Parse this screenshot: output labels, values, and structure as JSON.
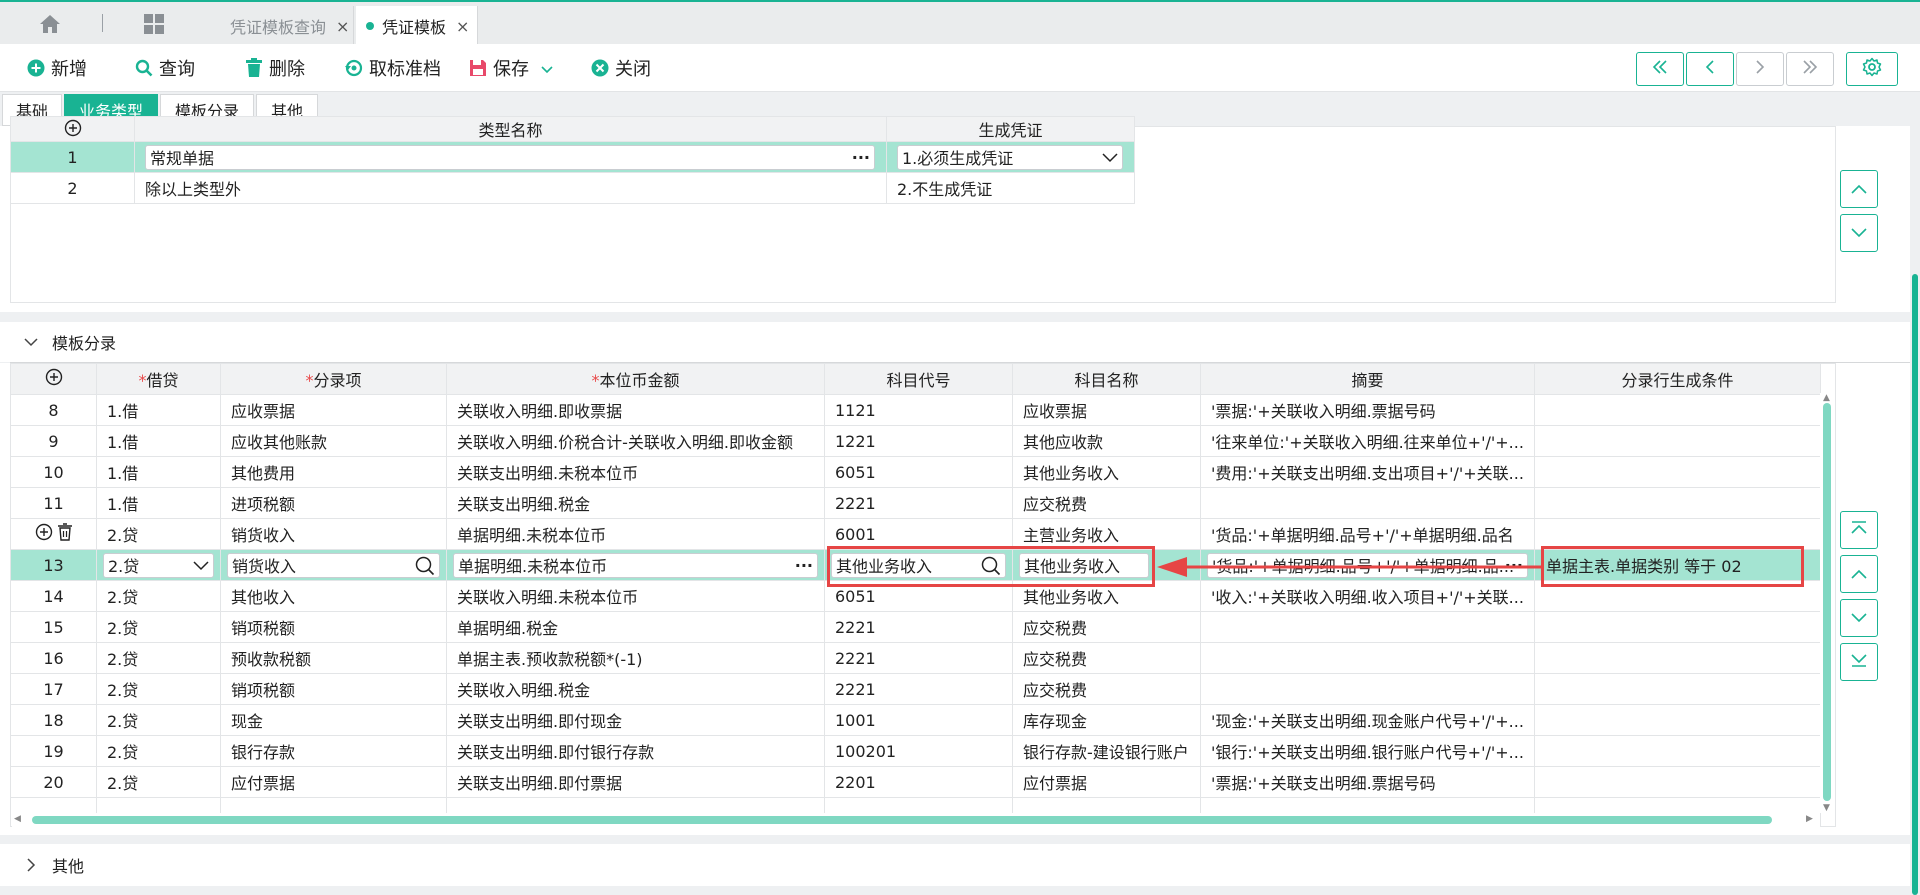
{
  "tabs": {
    "home_icon": "home-icon",
    "apps_icon": "grid-icon",
    "items": [
      {
        "label": "凭证模板查询",
        "close": "×",
        "active": false
      },
      {
        "label": "凭证模板",
        "close": "×",
        "active": true
      }
    ]
  },
  "toolbar": {
    "add": "新增",
    "query": "查询",
    "delete": "删除",
    "cancel_archive": "取标准档",
    "save": "保存",
    "close": "关闭"
  },
  "subtabs": [
    "基础",
    "业务类型",
    "模板分录",
    "其他"
  ],
  "business_types": {
    "columns": [
      "",
      "类型名称",
      "生成凭证"
    ],
    "rows": [
      {
        "no": "1",
        "name": "常规单据",
        "gen": "1.必须生成凭证"
      },
      {
        "no": "2",
        "name": "除以上类型外",
        "gen": "2.不生成凭证"
      }
    ]
  },
  "entries_section": {
    "title": "模板分录",
    "columns": [
      "借贷",
      "分录项",
      "本位币金额",
      "科目代号",
      "科目名称",
      "摘要",
      "分录行生成条件"
    ],
    "required": [
      true,
      true,
      true,
      false,
      false,
      false,
      false
    ],
    "rows": [
      {
        "no": "8",
        "dc": "1.借",
        "item": "应收票据",
        "amount": "关联收入明细.即收票据",
        "code": "1121",
        "name": "应收票据",
        "summary": "'票据:'+关联收入明细.票据号码",
        "cond": ""
      },
      {
        "no": "9",
        "dc": "1.借",
        "item": "应收其他账款",
        "amount": "关联收入明细.价税合计-关联收入明细.即收金额",
        "code": "1221",
        "name": "其他应收款",
        "summary": "'往来单位:'+关联收入明细.往来单位+'/'+...",
        "cond": ""
      },
      {
        "no": "10",
        "dc": "1.借",
        "item": "其他费用",
        "amount": "关联支出明细.未税本位币",
        "code": "6051",
        "name": "其他业务收入",
        "summary": "'费用:'+关联支出明细.支出项目+'/'+关联...",
        "cond": ""
      },
      {
        "no": "11",
        "dc": "1.借",
        "item": "进项税额",
        "amount": "关联支出明细.税金",
        "code": "2221",
        "name": "应交税费",
        "summary": "",
        "cond": ""
      },
      {
        "no": "",
        "dc": "2.贷",
        "item": "销货收入",
        "amount": "单据明细.未税本位币",
        "code": "6001",
        "name": "主营业务收入",
        "summary": "'货品:'+单据明细.品号+'/'+单据明细.品名",
        "cond": ""
      },
      {
        "no": "13",
        "dc": "2.贷",
        "item": "销货收入",
        "amount": "单据明细.未税本位币",
        "code": "其他业务收入",
        "name": "其他业务收入",
        "summary": "'货品:'+单据明细.品号+'/'+单据明细.品...",
        "cond": "单据主表.单据类别 等于  02",
        "editing": true
      },
      {
        "no": "14",
        "dc": "2.贷",
        "item": "其他收入",
        "amount": "关联收入明细.未税本位币",
        "code": "6051",
        "name": "其他业务收入",
        "summary": "'收入:'+关联收入明细.收入项目+'/'+关联...",
        "cond": ""
      },
      {
        "no": "15",
        "dc": "2.贷",
        "item": "销项税额",
        "amount": "单据明细.税金",
        "code": "2221",
        "name": "应交税费",
        "summary": "",
        "cond": ""
      },
      {
        "no": "16",
        "dc": "2.贷",
        "item": "预收款税额",
        "amount": "单据主表.预收款税额*(-1)",
        "code": "2221",
        "name": "应交税费",
        "summary": "",
        "cond": ""
      },
      {
        "no": "17",
        "dc": "2.贷",
        "item": "销项税额",
        "amount": "关联收入明细.税金",
        "code": "2221",
        "name": "应交税费",
        "summary": "",
        "cond": ""
      },
      {
        "no": "18",
        "dc": "2.贷",
        "item": "现金",
        "amount": "关联支出明细.即付现金",
        "code": "1001",
        "name": "库存现金",
        "summary": "'现金:'+关联支出明细.现金账户代号+'/'+...",
        "cond": ""
      },
      {
        "no": "19",
        "dc": "2.贷",
        "item": "银行存款",
        "amount": "关联支出明细.即付银行存款",
        "code": "100201",
        "name": "银行存款-建设银行账户",
        "summary": "'银行:'+关联支出明细.银行账户代号+'/'+...",
        "cond": ""
      },
      {
        "no": "20",
        "dc": "2.贷",
        "item": "应付票据",
        "amount": "关联支出明细.即付票据",
        "code": "2201",
        "name": "应付票据",
        "summary": "'票据:'+关联支出明细.票据号码",
        "cond": ""
      }
    ]
  },
  "other_section": {
    "title": "其他"
  },
  "colors": {
    "accent": "#19b393",
    "selected_row": "#a4e4d2",
    "highlight": "#e64545"
  }
}
